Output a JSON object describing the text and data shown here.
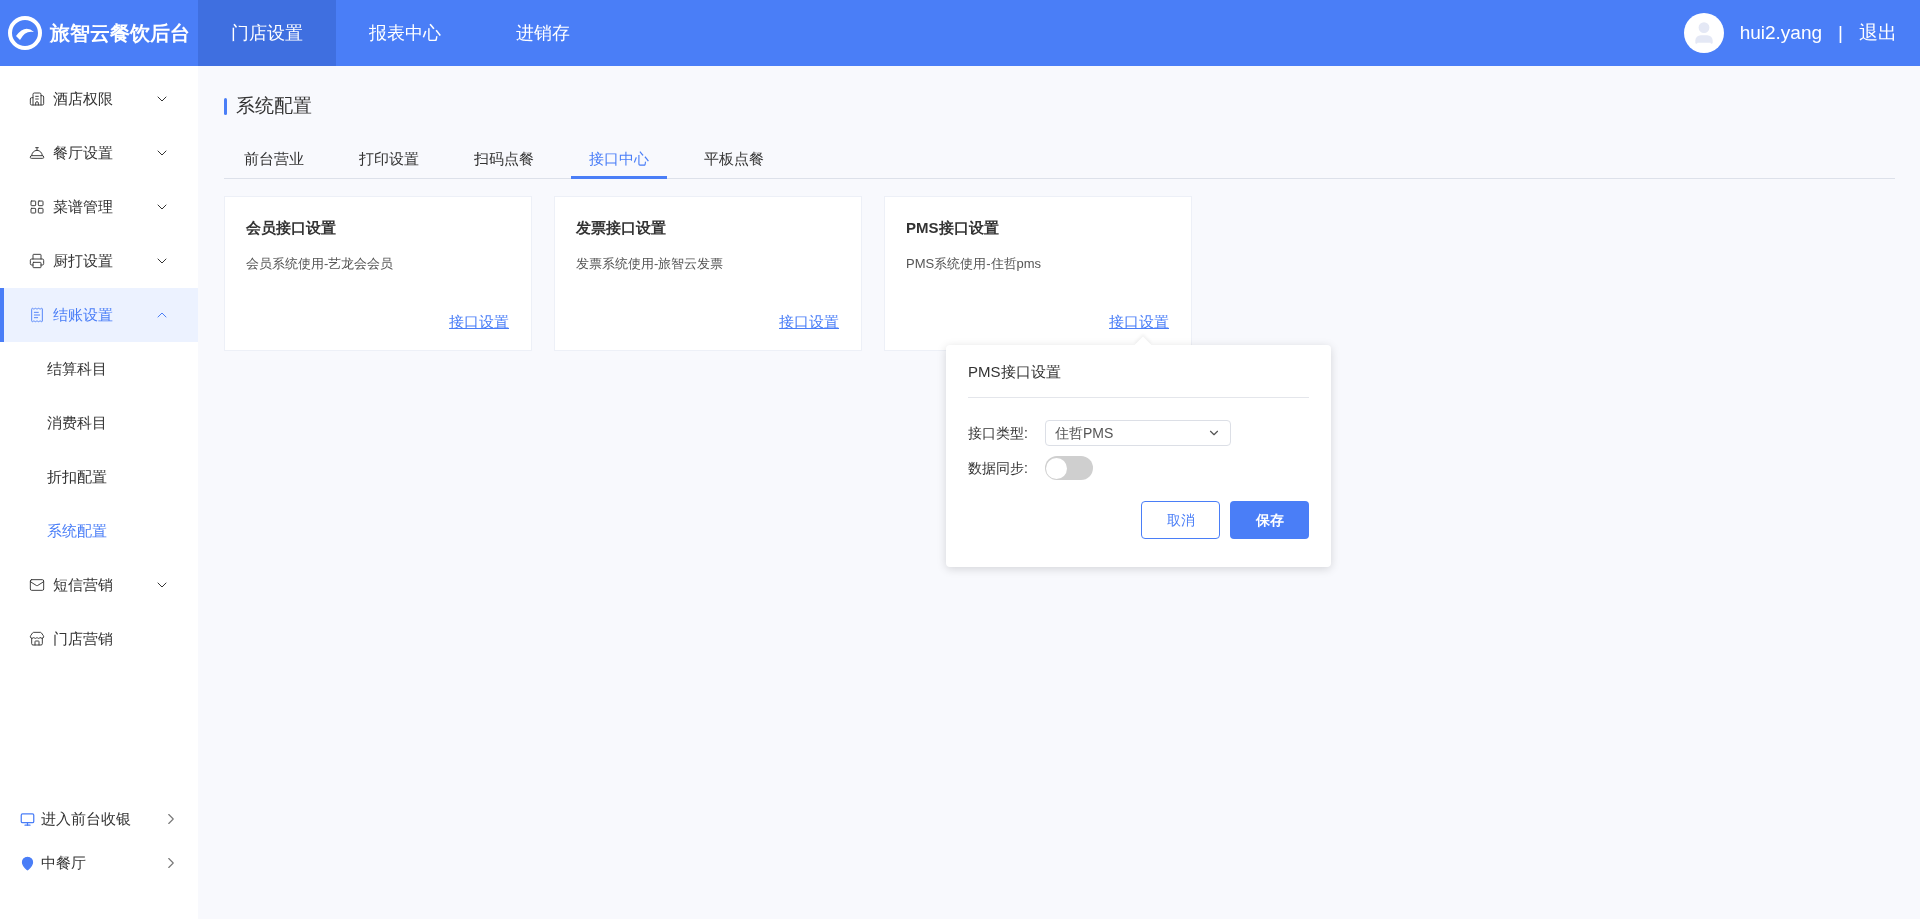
{
  "header": {
    "brand": "旅智云餐饮后台",
    "nav": [
      {
        "label": "门店设置",
        "selected": true
      },
      {
        "label": "报表中心",
        "selected": false
      },
      {
        "label": "进销存",
        "selected": false
      }
    ],
    "user": {
      "name": "hui2.yang",
      "separator": "|",
      "logout": "退出"
    }
  },
  "sidebar": {
    "items": [
      {
        "label": "酒店权限",
        "expanded": false,
        "selected": false
      },
      {
        "label": "餐厅设置",
        "expanded": false,
        "selected": false
      },
      {
        "label": "菜谱管理",
        "expanded": false,
        "selected": false
      },
      {
        "label": "厨打设置",
        "expanded": false,
        "selected": false
      },
      {
        "label": "结账设置",
        "expanded": true,
        "selected": true,
        "children": [
          {
            "label": "结算科目",
            "selected": false
          },
          {
            "label": "消费科目",
            "selected": false
          },
          {
            "label": "折扣配置",
            "selected": false
          },
          {
            "label": "系统配置",
            "selected": true
          }
        ]
      },
      {
        "label": "短信营销",
        "expanded": false,
        "selected": false
      },
      {
        "label": "门店营销",
        "selected": false
      }
    ],
    "footer": [
      {
        "label": "进入前台收银"
      },
      {
        "label": "中餐厅"
      }
    ]
  },
  "page": {
    "title": "系统配置",
    "tabs": [
      {
        "label": "前台营业",
        "selected": false
      },
      {
        "label": "打印设置",
        "selected": false
      },
      {
        "label": "扫码点餐",
        "selected": false
      },
      {
        "label": "接口中心",
        "selected": true
      },
      {
        "label": "平板点餐",
        "selected": false
      }
    ],
    "cards": [
      {
        "title": "会员接口设置",
        "description": "会员系统使用-艺龙会会员",
        "link": "接口设置"
      },
      {
        "title": "发票接口设置",
        "description": "发票系统使用-旅智云发票",
        "link": "接口设置"
      },
      {
        "title": "PMS接口设置",
        "description": "PMS系统使用-住哲pms",
        "link": "接口设置"
      }
    ]
  },
  "popover": {
    "title": "PMS接口设置",
    "type_label": "接口类型:",
    "type_value": "住哲PMS",
    "sync_label": "数据同步:",
    "sync_on": false,
    "cancel": "取消",
    "save": "保存"
  }
}
